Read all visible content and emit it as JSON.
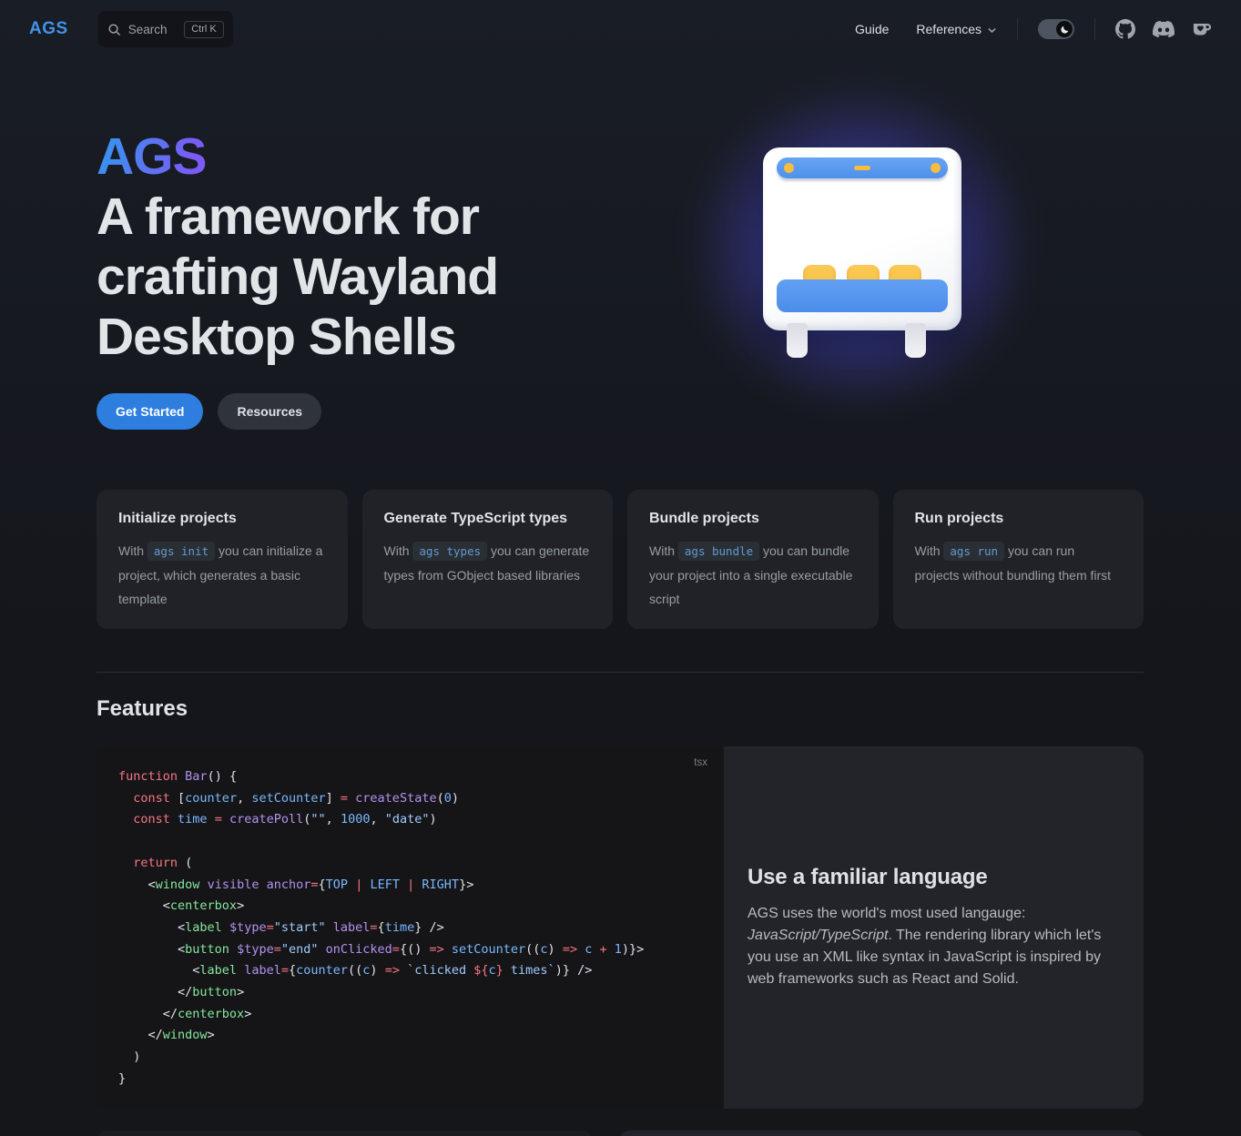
{
  "nav": {
    "logo": "AGS",
    "search": {
      "label": "Search",
      "shortcut": "Ctrl K"
    },
    "links": [
      {
        "label": "Guide"
      },
      {
        "label": "References",
        "has_dropdown": true
      }
    ],
    "icon_buttons": [
      "theme-toggle",
      "github",
      "discord",
      "kofi"
    ]
  },
  "hero": {
    "name": "AGS",
    "tagline": "A framework for\ncrafting Wayland\nDesktop Shells",
    "actions": [
      {
        "label": "Get Started",
        "style": "brand"
      },
      {
        "label": "Resources",
        "style": "alt"
      }
    ]
  },
  "feature_cards": [
    {
      "title": "Initialize projects",
      "desc": [
        [
          "t",
          "With "
        ],
        [
          "c",
          "ags init"
        ],
        [
          "t",
          " you can initialize a project, which generates a basic template"
        ]
      ]
    },
    {
      "title": "Generate TypeScript types",
      "desc": [
        [
          "t",
          "With "
        ],
        [
          "c",
          "ags types"
        ],
        [
          "t",
          " you can generate types from GObject based libraries"
        ]
      ]
    },
    {
      "title": "Bundle projects",
      "desc": [
        [
          "t",
          "With "
        ],
        [
          "c",
          "ags bundle"
        ],
        [
          "t",
          " you can bundle your project into a single executable script"
        ]
      ]
    },
    {
      "title": "Run projects",
      "desc": [
        [
          "t",
          "With "
        ],
        [
          "c",
          "ags run"
        ],
        [
          "t",
          " you can run projects without bundling them first"
        ]
      ]
    }
  ],
  "features_section": {
    "heading": "Features",
    "code_lang": "tsx",
    "code_lines": [
      [
        [
          "k",
          "function"
        ],
        [
          "d",
          " "
        ],
        [
          "f",
          "Bar"
        ],
        [
          "d",
          "() {"
        ]
      ],
      [
        [
          "d",
          "  "
        ],
        [
          "k",
          "const"
        ],
        [
          "d",
          " ["
        ],
        [
          "v",
          "counter"
        ],
        [
          "d",
          ", "
        ],
        [
          "v",
          "setCounter"
        ],
        [
          "d",
          "] "
        ],
        [
          "k",
          "="
        ],
        [
          "d",
          " "
        ],
        [
          "f",
          "createState"
        ],
        [
          "d",
          "("
        ],
        [
          "v",
          "0"
        ],
        [
          "d",
          ")"
        ]
      ],
      [
        [
          "d",
          "  "
        ],
        [
          "k",
          "const"
        ],
        [
          "d",
          " "
        ],
        [
          "v",
          "time"
        ],
        [
          "d",
          " "
        ],
        [
          "k",
          "="
        ],
        [
          "d",
          " "
        ],
        [
          "f",
          "createPoll"
        ],
        [
          "d",
          "("
        ],
        [
          "s",
          "\"\""
        ],
        [
          "d",
          ", "
        ],
        [
          "v",
          "1000"
        ],
        [
          "d",
          ", "
        ],
        [
          "s",
          "\"date\""
        ],
        [
          "d",
          ")"
        ]
      ],
      [],
      [
        [
          "d",
          "  "
        ],
        [
          "k",
          "return"
        ],
        [
          "d",
          " ("
        ]
      ],
      [
        [
          "d",
          "    <"
        ],
        [
          "g",
          "window"
        ],
        [
          "d",
          " "
        ],
        [
          "f",
          "visible"
        ],
        [
          "d",
          " "
        ],
        [
          "f",
          "anchor"
        ],
        [
          "k",
          "="
        ],
        [
          "d",
          "{"
        ],
        [
          "v",
          "TOP"
        ],
        [
          "d",
          " "
        ],
        [
          "k",
          "|"
        ],
        [
          "d",
          " "
        ],
        [
          "v",
          "LEFT"
        ],
        [
          "d",
          " "
        ],
        [
          "k",
          "|"
        ],
        [
          "d",
          " "
        ],
        [
          "v",
          "RIGHT"
        ],
        [
          "d",
          "}>"
        ]
      ],
      [
        [
          "d",
          "      <"
        ],
        [
          "g",
          "centerbox"
        ],
        [
          "d",
          ">"
        ]
      ],
      [
        [
          "d",
          "        <"
        ],
        [
          "g",
          "label"
        ],
        [
          "d",
          " "
        ],
        [
          "f",
          "$type"
        ],
        [
          "k",
          "="
        ],
        [
          "s",
          "\"start\""
        ],
        [
          "d",
          " "
        ],
        [
          "f",
          "label"
        ],
        [
          "k",
          "="
        ],
        [
          "d",
          "{"
        ],
        [
          "v",
          "time"
        ],
        [
          "d",
          "} />"
        ]
      ],
      [
        [
          "d",
          "        <"
        ],
        [
          "g",
          "button"
        ],
        [
          "d",
          " "
        ],
        [
          "f",
          "$type"
        ],
        [
          "k",
          "="
        ],
        [
          "s",
          "\"end\""
        ],
        [
          "d",
          " "
        ],
        [
          "f",
          "onClicked"
        ],
        [
          "k",
          "="
        ],
        [
          "d",
          "{() "
        ],
        [
          "k",
          "=>"
        ],
        [
          "d",
          " "
        ],
        [
          "v",
          "setCounter"
        ],
        [
          "d",
          "(("
        ],
        [
          "v",
          "c"
        ],
        [
          "d",
          ") "
        ],
        [
          "k",
          "=>"
        ],
        [
          "d",
          " "
        ],
        [
          "v",
          "c"
        ],
        [
          "d",
          " "
        ],
        [
          "k",
          "+"
        ],
        [
          "d",
          " "
        ],
        [
          "v",
          "1"
        ],
        [
          "d",
          ")}>"
        ]
      ],
      [
        [
          "d",
          "          <"
        ],
        [
          "g",
          "label"
        ],
        [
          "d",
          " "
        ],
        [
          "f",
          "label"
        ],
        [
          "k",
          "="
        ],
        [
          "d",
          "{"
        ],
        [
          "v",
          "counter"
        ],
        [
          "d",
          "(("
        ],
        [
          "v",
          "c"
        ],
        [
          "d",
          ") "
        ],
        [
          "k",
          "=>"
        ],
        [
          "d",
          " "
        ],
        [
          "s",
          "`clicked "
        ],
        [
          "k",
          "${"
        ],
        [
          "v",
          "c"
        ],
        [
          "k",
          "}"
        ],
        [
          "s",
          " times`"
        ],
        [
          "d",
          ")} />"
        ]
      ],
      [
        [
          "d",
          "        </"
        ],
        [
          "g",
          "button"
        ],
        [
          "d",
          ">"
        ]
      ],
      [
        [
          "d",
          "      </"
        ],
        [
          "g",
          "centerbox"
        ],
        [
          "d",
          ">"
        ]
      ],
      [
        [
          "d",
          "    </"
        ],
        [
          "g",
          "window"
        ],
        [
          "d",
          ">"
        ]
      ],
      [
        [
          "d",
          "  )"
        ]
      ],
      [
        [
          "d",
          "}"
        ]
      ]
    ],
    "panel": {
      "heading": "Use a familiar language",
      "paragraph": [
        [
          "t",
          "AGS uses the world's most used langauge: "
        ],
        [
          "i",
          "JavaScript/TypeScript"
        ],
        [
          "t",
          ". The rendering library which let's you use an XML like syntax in JavaScript is inspired by web frameworks such as React and Solid."
        ]
      ]
    }
  },
  "colors": {
    "brand_gradient_from": "#3f8df0",
    "brand_gradient_to": "#7a5bf6",
    "brand_button": "#2e7ee0",
    "nav_logo": "#4193ea",
    "inline_code_accent": "#639ad1",
    "glow": "#4358e4",
    "illustration_blue": "#5a9af0",
    "illustration_yellow": "#f4bd40",
    "code_tokens": {
      "d": "#e1e4e8",
      "k": "#f97583",
      "f": "#b392f0",
      "v": "#79b8ff",
      "s": "#9ecbff",
      "g": "#85e89d"
    }
  }
}
